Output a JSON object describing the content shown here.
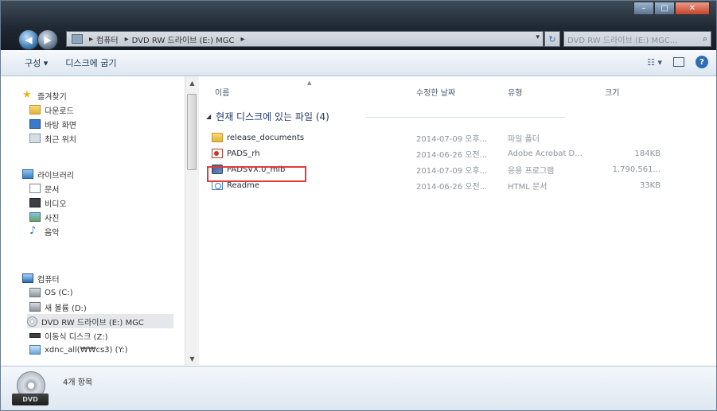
{
  "window": {
    "controls": {
      "min": "–",
      "max": "□",
      "close": "✕"
    }
  },
  "address": {
    "crumbs": [
      "컴퓨터",
      "DVD RW 드라이브 (E:) MGC"
    ],
    "search_placeholder": "DVD RW 드라이브 (E:) MGC..."
  },
  "toolbar": {
    "organize": "구성 ▾",
    "burn": "디스크에 굽기"
  },
  "nav": {
    "favorites_label": "즐겨찾기",
    "favorites": [
      "다운로드",
      "바탕 화면",
      "최근 위치"
    ],
    "libraries_label": "라이브러리",
    "libraries": [
      "문서",
      "비디오",
      "사진",
      "음악"
    ],
    "computer_label": "컴퓨터",
    "drives": [
      "OS (C:)",
      "새 볼륨 (D:)",
      "DVD RW 드라이브 (E:) MGC",
      "이동식 디스크 (Z:)",
      "xdnc_all(₩₩cs3) (Y:)"
    ]
  },
  "content": {
    "columns": {
      "name": "이름",
      "date": "수정한 날짜",
      "type": "유형",
      "size": "크기"
    },
    "group_label": "현재 디스크에 있는 파일 (4)",
    "files": [
      {
        "name": "release_documents",
        "date": "2014-07-09 오후...",
        "type": "파일 폴더",
        "size": "",
        "icon": "folder-icon"
      },
      {
        "name": "PADS_rh",
        "date": "2014-06-26 오전...",
        "type": "Adobe Acrobat D...",
        "size": "184KB",
        "icon": "pdf-icon"
      },
      {
        "name": "PADSVX.0_mib",
        "date": "2014-07-09 오후...",
        "type": "응용 프로그램",
        "size": "1,790,561...",
        "icon": "setup-icon"
      },
      {
        "name": "Readme",
        "date": "2014-06-26 오전...",
        "type": "HTML 문서",
        "size": "33KB",
        "icon": "html-icon"
      }
    ]
  },
  "details": {
    "count": "4개 항목",
    "drive_badge": "DVD"
  },
  "colors": {
    "selection_outline": "#e23b3b",
    "title_bar": "#1f2833"
  }
}
